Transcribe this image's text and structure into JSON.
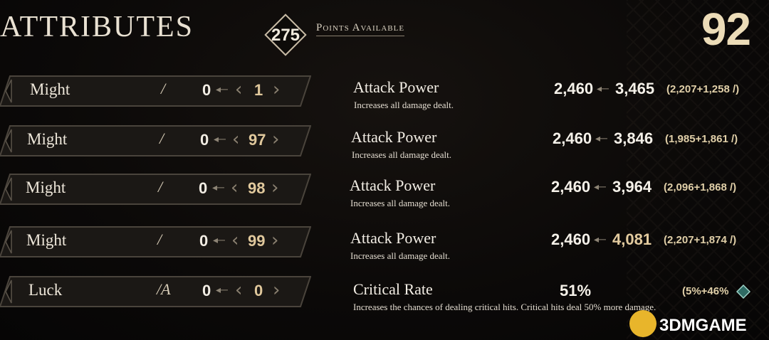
{
  "header": {
    "title": "ATTRIBUTES",
    "points_available": "275",
    "points_label": "Points Available",
    "level": "92"
  },
  "attributes": [
    {
      "name": "Might",
      "icon": "/",
      "base": "0",
      "new_value": "1"
    },
    {
      "name": "Might",
      "icon": "/",
      "base": "0",
      "new_value": "97"
    },
    {
      "name": "Might",
      "icon": "/",
      "base": "0",
      "new_value": "98"
    },
    {
      "name": "Might",
      "icon": "/",
      "base": "0",
      "new_value": "99"
    },
    {
      "name": "Luck",
      "icon": "/A",
      "base": "0",
      "new_value": "0"
    }
  ],
  "stats": [
    {
      "name": "Attack Power",
      "description": "Increases all damage dealt.",
      "current": "2,460",
      "projected": "3,465",
      "breakdown": "(2,207+1,258 /)"
    },
    {
      "name": "Attack Power",
      "description": "Increases all damage dealt.",
      "current": "2,460",
      "projected": "3,846",
      "breakdown": "(1,985+1,861 /)"
    },
    {
      "name": "Attack Power",
      "description": "Increases all damage dealt.",
      "current": "2,460",
      "projected": "3,964",
      "breakdown": "(2,096+1,868 /)"
    },
    {
      "name": "Attack Power",
      "description": "Increases all damage dealt.",
      "current": "2,460",
      "projected": "4,081",
      "breakdown": "(2,207+1,874 /)"
    },
    {
      "name": "Critical Rate",
      "description": "Increases the chances of dealing critical hits. Critical hits deal 50% more damage.",
      "current": "51%",
      "projected": "",
      "breakdown": "(5%+46%"
    }
  ],
  "watermark": {
    "text": "3DMGAME"
  },
  "colors": {
    "gold": "#e3cb9f",
    "frame": "#3b3631",
    "level": "#ecdcb8"
  }
}
